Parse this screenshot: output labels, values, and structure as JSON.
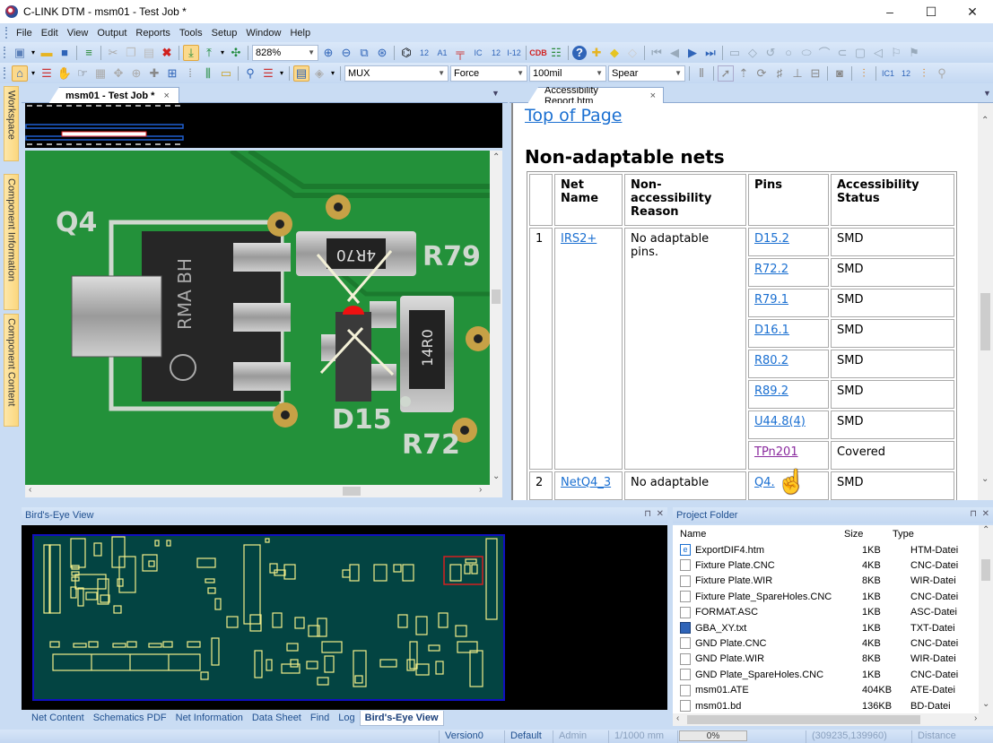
{
  "window": {
    "title": "C-LINK DTM - msm01 - Test Job *",
    "minimize": "–",
    "maximize": "☐",
    "close": "✕"
  },
  "menu": [
    "File",
    "Edit",
    "View",
    "Output",
    "Reports",
    "Tools",
    "Setup",
    "Window",
    "Help"
  ],
  "toolbar1": {
    "zoom_value": "828%"
  },
  "toolbar2": {
    "mux_value": "MUX",
    "force_value": "Force",
    "grid_value": "100mil",
    "probe_value": "Spear"
  },
  "side_tabs": [
    "Workspace",
    "Component Information",
    "Component Content"
  ],
  "left_doc": {
    "tab_label": "msm01 - Test Job *",
    "close": "×"
  },
  "pcb_labels": {
    "q4": "Q4",
    "r79": "R79",
    "d15": "D15",
    "r72": "R72",
    "chip_mark": "RMA\nBH",
    "r79_value": "4R70",
    "r72_value": "14R0"
  },
  "right_doc": {
    "tab_label": "Accessibility Report.htm",
    "close": "×"
  },
  "report": {
    "top_link": "Top of Page",
    "heading": "Non-adaptable nets",
    "columns": [
      "",
      "Net Name",
      "Non-accessibility Reason",
      "Pins",
      "Accessibility Status"
    ],
    "rows": [
      {
        "num": "1",
        "net": "IRS2+",
        "reason": "No adaptable pins.",
        "pins": [
          {
            "pin": "D15.2",
            "status": "SMD"
          },
          {
            "pin": "R72.2",
            "status": "SMD"
          },
          {
            "pin": "R79.1",
            "status": "SMD"
          },
          {
            "pin": "D16.1",
            "status": "SMD"
          },
          {
            "pin": "R80.2",
            "status": "SMD"
          },
          {
            "pin": "R89.2",
            "status": "SMD"
          },
          {
            "pin": "U44.8(4)",
            "status": "SMD"
          },
          {
            "pin": "TPn201",
            "status": "Covered",
            "visited": true
          }
        ]
      },
      {
        "num": "2",
        "net": "NetQ4_3",
        "reason": "No adaptable",
        "pins": [
          {
            "pin": "Q4.",
            "status": "SMD"
          }
        ]
      }
    ]
  },
  "birds_eye": {
    "title": "Bird's-Eye View",
    "pin": "⊓",
    "close": "✕"
  },
  "bottom_tabs": [
    "Net Content",
    "Schematics PDF",
    "Net Information",
    "Data Sheet",
    "Find",
    "Log",
    "Bird's-Eye View"
  ],
  "bottom_tab_active": "Bird's-Eye View",
  "project_folder": {
    "title": "Project Folder",
    "columns": [
      "Name",
      "Size",
      "Type"
    ],
    "files": [
      {
        "name": "ExportDIF4.htm",
        "size": "1KB",
        "type": "HTM-Datei",
        "icon": "html-file-icon"
      },
      {
        "name": "Fixture Plate.CNC",
        "size": "4KB",
        "type": "CNC-Datei",
        "icon": "file-icon"
      },
      {
        "name": "Fixture Plate.WIR",
        "size": "8KB",
        "type": "WIR-Datei",
        "icon": "file-icon"
      },
      {
        "name": "Fixture Plate_SpareHoles.CNC",
        "size": "1KB",
        "type": "CNC-Datei",
        "icon": "file-icon"
      },
      {
        "name": "FORMAT.ASC",
        "size": "1KB",
        "type": "ASC-Datei",
        "icon": "file-icon"
      },
      {
        "name": "GBA_XY.txt",
        "size": "1KB",
        "type": "TXT-Datei",
        "icon": "text-editor-icon"
      },
      {
        "name": "GND Plate.CNC",
        "size": "4KB",
        "type": "CNC-Datei",
        "icon": "file-icon"
      },
      {
        "name": "GND Plate.WIR",
        "size": "8KB",
        "type": "WIR-Datei",
        "icon": "file-icon"
      },
      {
        "name": "GND Plate_SpareHoles.CNC",
        "size": "1KB",
        "type": "CNC-Datei",
        "icon": "file-icon"
      },
      {
        "name": "msm01.ATE",
        "size": "404KB",
        "type": "ATE-Datei",
        "icon": "file-icon"
      },
      {
        "name": "msm01.bd",
        "size": "136KB",
        "type": "BD-Datei",
        "icon": "file-icon"
      }
    ]
  },
  "status": {
    "version": "Version0",
    "profile": "Default",
    "user": "Admin",
    "units": "1/1000 mm",
    "progress": "0%",
    "progress_value": 0,
    "coords": "(309235,139960)",
    "mode": "Distance"
  },
  "colors": {
    "accent": "#1f4f8f",
    "link": "#1a6fd1",
    "visited": "#8a2a9e",
    "pcb_green": "#1f8a2f",
    "bev_board": "#034442",
    "bev_outline": "#f2ee8a",
    "selection": "#d42020"
  }
}
